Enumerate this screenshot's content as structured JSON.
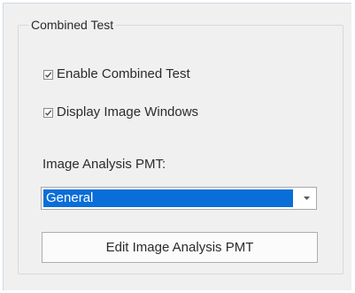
{
  "group": {
    "title": "Combined Test"
  },
  "checkboxes": [
    {
      "label": "Enable Combined Test",
      "checked": true
    },
    {
      "label": "Display Image Windows",
      "checked": true
    }
  ],
  "image_analysis": {
    "label": "Image Analysis PMT:",
    "selected": "General",
    "edit_button_label": "Edit Image Analysis PMT"
  },
  "colors": {
    "panel_background": "#f0f0f0",
    "selection_highlight": "#0a6ed8",
    "selection_text": "#ffffff"
  }
}
